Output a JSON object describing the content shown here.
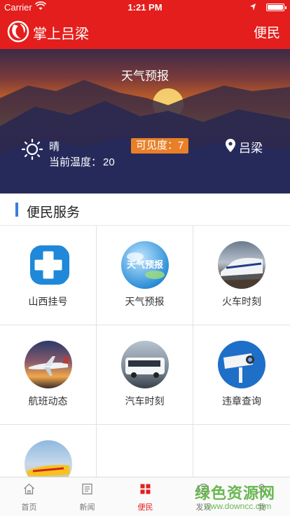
{
  "status_bar": {
    "carrier": "Carrier",
    "time": "1:21 PM"
  },
  "nav": {
    "title": "掌上吕梁",
    "right_label": "便民"
  },
  "weather": {
    "title": "天气预报",
    "condition": "晴",
    "temp_label": "当前温度：",
    "temp_value": "20",
    "visibility": "可见度：7",
    "city": "吕梁"
  },
  "section": {
    "title": "便民服务"
  },
  "services": [
    {
      "label": "山西挂号",
      "icon": "medical-cross-icon"
    },
    {
      "label": "天气预报",
      "icon": "weather-forecast-icon"
    },
    {
      "label": "火车时刻",
      "icon": "train-icon"
    },
    {
      "label": "航班动态",
      "icon": "airplane-icon"
    },
    {
      "label": "汽车时刻",
      "icon": "bus-icon"
    },
    {
      "label": "违章查询",
      "icon": "traffic-camera-icon"
    },
    {
      "label": "",
      "icon": "courier-plane-icon"
    }
  ],
  "tabs": [
    {
      "label": "首页",
      "icon": "home-icon",
      "active": false
    },
    {
      "label": "新闻",
      "icon": "news-icon",
      "active": false
    },
    {
      "label": "便民",
      "icon": "grid-icon",
      "active": true
    },
    {
      "label": "发现",
      "icon": "discover-icon",
      "active": false
    },
    {
      "label": "我",
      "icon": "user-icon",
      "active": false
    }
  ],
  "watermark": {
    "line1": "绿色资源网",
    "line2": "www.downcc.com"
  },
  "colors": {
    "brand_red": "#e41e1c",
    "accent_blue": "#3b7ddd",
    "visibility_badge": "#e8802a"
  }
}
